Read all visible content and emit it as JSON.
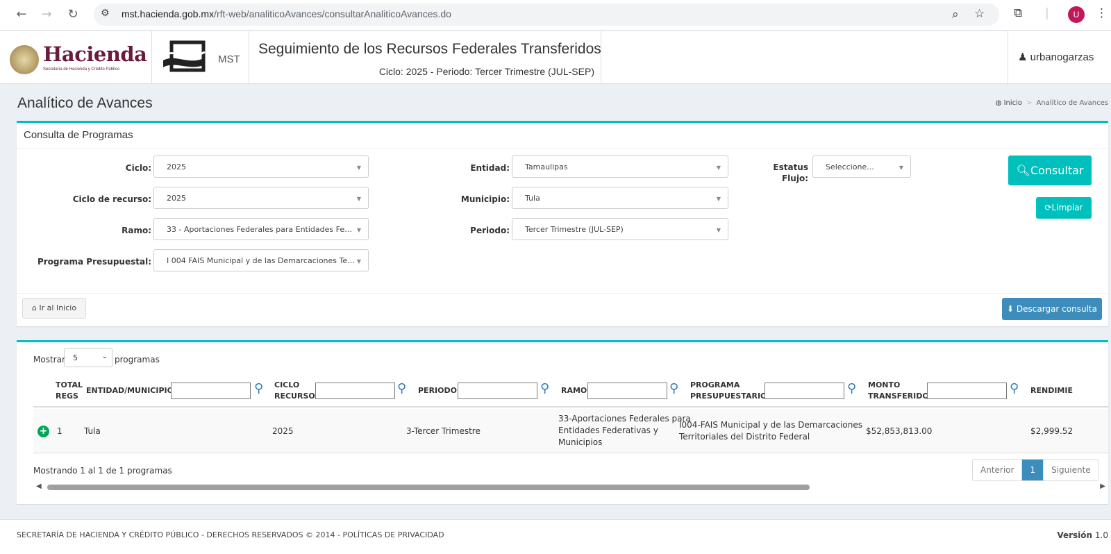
{
  "browser": {
    "url_host": "mst.hacienda.gob.mx",
    "url_path": "/rft-web/analiticoAvances/consultarAnaliticoAvances.do",
    "profile_initial": "U"
  },
  "header": {
    "logo_text": "Hacienda",
    "logo_sub": "Secretaría de Hacienda y Crédito Público",
    "mst_label": "MST",
    "system_title": "Seguimiento de los Recursos Federales Transferidos",
    "system_subtitle": "Ciclo: 2025 - Periodo: Tercer Trimestre (JUL-SEP)",
    "user": "urbanogarzas"
  },
  "page": {
    "title": "Analítico de Avances",
    "breadcrumb": [
      "Inicio",
      "Analítico de Avances"
    ]
  },
  "filters": {
    "box_title": "Consulta de Programas",
    "ciclo": {
      "label": "Ciclo:",
      "value": "2025"
    },
    "ciclo_recurso": {
      "label": "Ciclo de recurso:",
      "value": "2025"
    },
    "ramo": {
      "label": "Ramo:",
      "value": "33 - Aportaciones Federales para Entidades Fe…"
    },
    "programa": {
      "label": "Programa Presupuestal:",
      "value": "I 004 FAIS Municipal y de las Demarcaciones Te…"
    },
    "entidad": {
      "label": "Entidad:",
      "value": "Tamaulipas"
    },
    "municipio": {
      "label": "Municipio:",
      "value": "Tula"
    },
    "periodo": {
      "label": "Periodo:",
      "value": "Tercer Trimestre (JUL-SEP)"
    },
    "estatus": {
      "label_line1": "Estatus",
      "label_line2": "Flujo:",
      "value": "Seleccione..."
    },
    "consultar": "Consultar",
    "limpiar": "Limpiar",
    "ir_inicio": "Ir al Inicio",
    "descargar": "Descargar consulta"
  },
  "table": {
    "mostrar": "Mostrar",
    "page_length": "5",
    "programas": "programas",
    "headers": {
      "total_regs": [
        "TOTAL",
        "REGS"
      ],
      "entidad": "ENTIDAD/MUNICIPIO",
      "ciclo": [
        "CICLO",
        "RECURSO"
      ],
      "periodo": "PERIODO",
      "ramo": "RAMO",
      "programa": [
        "PROGRAMA",
        "PRESUPUESTARIO"
      ],
      "monto": [
        "MONTO",
        "TRANSFERIDO"
      ],
      "rendimiento": "RENDIMIE"
    },
    "rows": [
      {
        "total": "1",
        "entidad": "Tula",
        "ciclo": "2025",
        "periodo": "3-Tercer Trimestre",
        "ramo": [
          "33-Aportaciones Federales para",
          "Entidades Federativas y",
          "Municipios"
        ],
        "programa": [
          "I004-FAIS Municipal y de las Demarcaciones",
          "Territoriales del Distrito Federal"
        ],
        "monto": "$52,853,813.00",
        "rendimiento": "$2,999.52"
      }
    ],
    "info": "Mostrando 1 al 1 de 1 programas",
    "pager": {
      "prev": "Anterior",
      "current": "1",
      "next": "Siguiente"
    }
  },
  "footer": {
    "left": "SECRETARÍA DE HACIENDA Y CRÉDITO PÚBLICO - DERECHOS RESERVADOS © 2014 - POLÍTICAS DE PRIVACIDAD",
    "version_label": "Versión",
    "version": "1.0"
  },
  "colors": {
    "accent": "#00c0bd",
    "primary": "#3c8dbc",
    "brand": "#6a1a3a"
  }
}
